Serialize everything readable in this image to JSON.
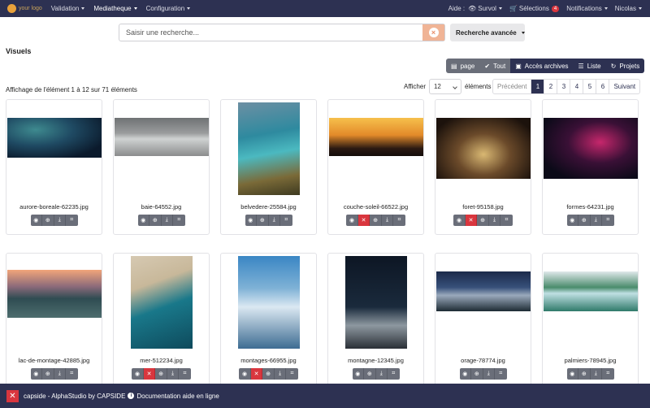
{
  "navbar": {
    "logo_text": "your logo",
    "menu": [
      {
        "label": "Validation"
      },
      {
        "label": "Mediatheque"
      },
      {
        "label": "Configuration"
      }
    ],
    "right": {
      "aide": "Aide :",
      "survol": "Survol",
      "selections": "Sélections",
      "selections_count": "4",
      "notifications": "Notifications",
      "user": "Nicolas"
    }
  },
  "search": {
    "placeholder": "Saisir une recherche...",
    "advanced_label": "Recherche avancée"
  },
  "section_title": "Visuels",
  "toolbar": [
    {
      "label": "page",
      "icon": "file-icon"
    },
    {
      "label": "Tout",
      "icon": "check-circle-icon"
    },
    {
      "label": "Accès archives",
      "icon": "archive-icon"
    },
    {
      "label": "Liste",
      "icon": "list-icon"
    },
    {
      "label": "Projets",
      "icon": "refresh-icon"
    }
  ],
  "results_info": "Affichage de l'élément 1 à 12 sur 71 éléments",
  "per_page": {
    "prefix": "Afficher",
    "value": "12",
    "suffix": "éléments"
  },
  "pagination": {
    "prev": "Précédent",
    "pages": [
      "1",
      "2",
      "3",
      "4",
      "5",
      "6"
    ],
    "current": "1",
    "next": "Suivant"
  },
  "items": [
    {
      "filename": "aurore-boreale-62235.jpg",
      "deletable": false
    },
    {
      "filename": "baie-64552.jpg",
      "deletable": false
    },
    {
      "filename": "belvedere-25584.jpg",
      "deletable": false
    },
    {
      "filename": "couche-soleil-66522.jpg",
      "deletable": true
    },
    {
      "filename": "foret-95158.jpg",
      "deletable": true
    },
    {
      "filename": "formes-64231.jpg",
      "deletable": false
    },
    {
      "filename": "lac-de-montage-42885.jpg",
      "deletable": false
    },
    {
      "filename": "mer-512234.jpg",
      "deletable": true
    },
    {
      "filename": "montages-66955.jpg",
      "deletable": true
    },
    {
      "filename": "montagne-12345.jpg",
      "deletable": false
    },
    {
      "filename": "orage-78774.jpg",
      "deletable": false
    },
    {
      "filename": "palmiers-78945.jpg",
      "deletable": false
    }
  ],
  "footer": {
    "app": "capside - AlphaStudio by CAPSIDE",
    "doc": "Documentation aide en ligne"
  },
  "colors": {
    "navbar": "#2d3152",
    "accent_red": "#d9363e",
    "action_gray": "#6a6e79"
  }
}
